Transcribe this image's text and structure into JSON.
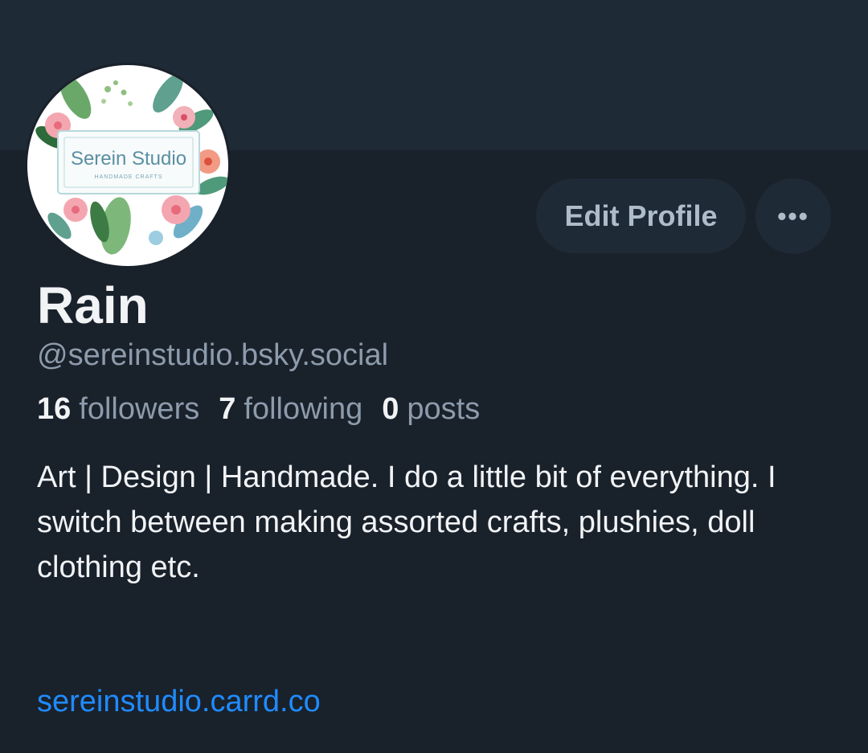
{
  "profile": {
    "avatar_title": "Serein Studio",
    "avatar_subtitle": "HANDMADE CRAFTS",
    "name": "Rain",
    "handle": "@sereinstudio.bsky.social",
    "stats": {
      "followers_count": "16",
      "followers_label": "followers",
      "following_count": "7",
      "following_label": "following",
      "posts_count": "0",
      "posts_label": "posts"
    },
    "bio": "Art | Design | Handmade. I do a little bit of everything. I switch between making assorted crafts, plushies, doll clothing etc.",
    "link": "sereinstudio.carrd.co"
  },
  "actions": {
    "edit_label": "Edit Profile",
    "more_icon": "ellipsis-icon",
    "more_glyph": "•••"
  },
  "colors": {
    "background": "#19212b",
    "banner": "#1f2a37",
    "button_bg": "#1f2a37",
    "text_primary": "#f1f3f5",
    "text_secondary": "#8d9bab",
    "link": "#208bfe"
  }
}
